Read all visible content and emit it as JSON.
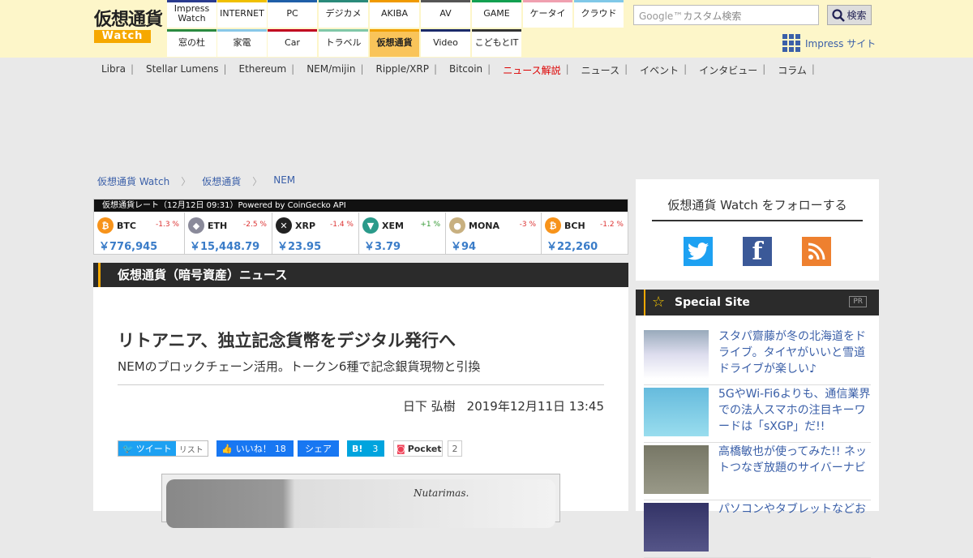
{
  "logo": {
    "line1": "仮想通貨",
    "line2": "Watch"
  },
  "nav_top": [
    {
      "label": "Impress\nWatch",
      "color": "#2a3b8f"
    },
    {
      "label": "INTERNET",
      "color": "#f0c000"
    },
    {
      "label": "PC",
      "color": "#1f5fa8"
    },
    {
      "label": "デジカメ",
      "color": "#2a8a7a"
    },
    {
      "label": "AKIBA",
      "color": "#f09a00"
    },
    {
      "label": "AV",
      "color": "#555555"
    },
    {
      "label": "GAME",
      "color": "#12a050"
    },
    {
      "label": "ケータイ",
      "color": "#f0a0b0"
    },
    {
      "label": "クラウド",
      "color": "#80c8e8"
    }
  ],
  "nav_bottom": [
    {
      "label": "窓の杜",
      "color": "#2a8a40"
    },
    {
      "label": "家電",
      "color": "#88c8e8"
    },
    {
      "label": "Car",
      "color": "#c00020"
    },
    {
      "label": "トラベル",
      "color": "#80c8a8"
    },
    {
      "label": "仮想通貨",
      "color": "#f0a000",
      "active": true
    },
    {
      "label": "Video",
      "color": "#1a2a6a"
    },
    {
      "label": "こどもとIT",
      "color": "#333333"
    }
  ],
  "search": {
    "placeholder": "カスタム検索",
    "google": "Google™",
    "button": "検索"
  },
  "impress_site": "Impress サイト",
  "subnav": [
    {
      "label": "Libra"
    },
    {
      "label": "Stellar Lumens"
    },
    {
      "label": "Ethereum"
    },
    {
      "label": "NEM/mijin"
    },
    {
      "label": "Ripple/XRP"
    },
    {
      "label": "Bitcoin"
    },
    {
      "label": "ニュース解説",
      "red": true
    },
    {
      "label": "ニュース"
    },
    {
      "label": "イベント"
    },
    {
      "label": "インタビュー"
    },
    {
      "label": "コラム"
    }
  ],
  "breadcrumb": [
    "仮想通貨 Watch",
    "仮想通貨",
    "NEM"
  ],
  "rates": {
    "header": "仮想通貨レート（12月12日 09:31）Powered by CoinGecko API",
    "coins": [
      {
        "symbol": "BTC",
        "change": "-1.3 %",
        "price": "￥776,945",
        "color": "#f7931a",
        "icon": "₿"
      },
      {
        "symbol": "ETH",
        "change": "-2.5 %",
        "price": "￥15,448.79",
        "color": "#8a8a9a",
        "icon": "◆"
      },
      {
        "symbol": "XRP",
        "change": "-1.4 %",
        "price": "￥23.95",
        "color": "#222222",
        "icon": "✕"
      },
      {
        "symbol": "XEM",
        "change": "+1 %",
        "price": "￥3.79",
        "color": "#2a9a8a",
        "icon": "▼"
      },
      {
        "symbol": "MONA",
        "change": "-3 %",
        "price": "￥94",
        "color": "#c8b080",
        "icon": "●"
      },
      {
        "symbol": "BCH",
        "change": "-1.2 %",
        "price": "￥22,260",
        "color": "#f7931a",
        "icon": "₿"
      }
    ]
  },
  "section_title": "仮想通貨（暗号資産）ニュース",
  "article": {
    "title": "リトアニア、独立記念貨幣をデジタル発行へ",
    "subtitle": "NEMのブロックチェーン活用。トークン6種で記念銀貨現物と引換",
    "author": "日下 弘樹",
    "date": "2019年12月11日 13:45",
    "image_text": "Nutarimas."
  },
  "social": {
    "tweet": "ツイート",
    "list": "リスト",
    "like": "いいね！",
    "like_count": "18",
    "share": "シェア",
    "hatena": "B!",
    "hatena_count": "3",
    "pocket": "Pocket",
    "pocket_count": "2"
  },
  "follow": {
    "title": "仮想通貨 Watch をフォローする"
  },
  "special": {
    "title": "Special Site",
    "pr": "PR",
    "items": [
      {
        "text": "スタパ齋藤が冬の北海道をドライブ。タイヤがいいと雪道ドライブが楽しい♪"
      },
      {
        "text": "5GやWi-Fi6よりも、通信業界での法人スマホの注目キーワードは「sXGP」だ!!"
      },
      {
        "text": "高橋敏也が使ってみた!! ネットつなぎ放題のサイバーナビ"
      },
      {
        "text": "パソコンやタブレットなどお"
      }
    ]
  }
}
